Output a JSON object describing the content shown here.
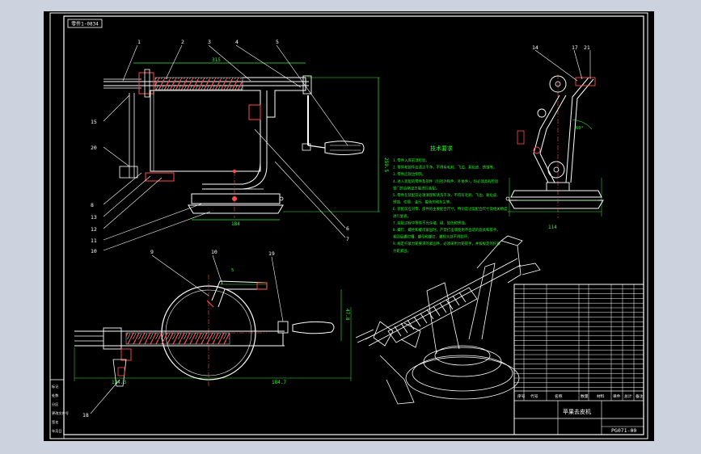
{
  "drawing": {
    "corner_tag": "零件1-0834",
    "balloons": {
      "front": [
        "1",
        "2",
        "3",
        "4",
        "5",
        "15",
        "20",
        "6",
        "7",
        "8",
        "13",
        "12",
        "11",
        "10"
      ],
      "top": [
        "9",
        "10",
        "19",
        "18"
      ],
      "side": [
        "14",
        "17",
        "21"
      ]
    },
    "dimensions": {
      "front_width": "315",
      "front_height": "259.5",
      "base_width": "184",
      "top_overall": "425.7",
      "top_left": "124.3",
      "top_right": "184.7",
      "top_height": "47.8",
      "top_small": "5",
      "side_base": "114",
      "side_angle": "60°"
    },
    "tech_title": "技术要求",
    "tech_lines": [
      "1.零件入库前须检验。",
      "2.零件和部件应清洁干净，不得有毛刺、飞边、氧化皮、锈蚀等。",
      "3.零件应锐边倒钝。",
      "4.进入装配的零件及部件（包括外购件、外协件），均必须具有检验",
      "  部门的合格证方能进行装配。",
      "5.零件在装配前必须清理和清洗干净，不得有毛刺、飞边、氧化皮、",
      "  锈蚀、切屑、油污、着色剂和灰尘等。",
      "6.装配前应对零、部件的主要配合尺寸，特别是过盈配合尺寸及相关精度",
      "  进行复查。",
      "7.装配过程中零件不允许磕、碰、划伤和锈蚀。",
      "8.螺钉、螺栓和螺母紧固时，严禁打击或使用不合适的旋具和扳手。",
      "  紧固后螺钉槽、螺母和螺钉、螺栓头部不得损坏。",
      "9.规定拧紧力矩要求的紧固件，必须采用力矩扳手，并按规定的拧紧",
      "  力矩紧固。"
    ],
    "title_block": {
      "title": "苹果去皮机",
      "drawing_no": "PG071-00",
      "footer_labels": [
        "序号",
        "代号",
        "名称",
        "数量",
        "材料",
        "单件",
        "总计",
        "备注"
      ],
      "left_strip": [
        "标记",
        "处数",
        "分区",
        "更改文件号",
        "签名",
        "年月日"
      ]
    }
  }
}
